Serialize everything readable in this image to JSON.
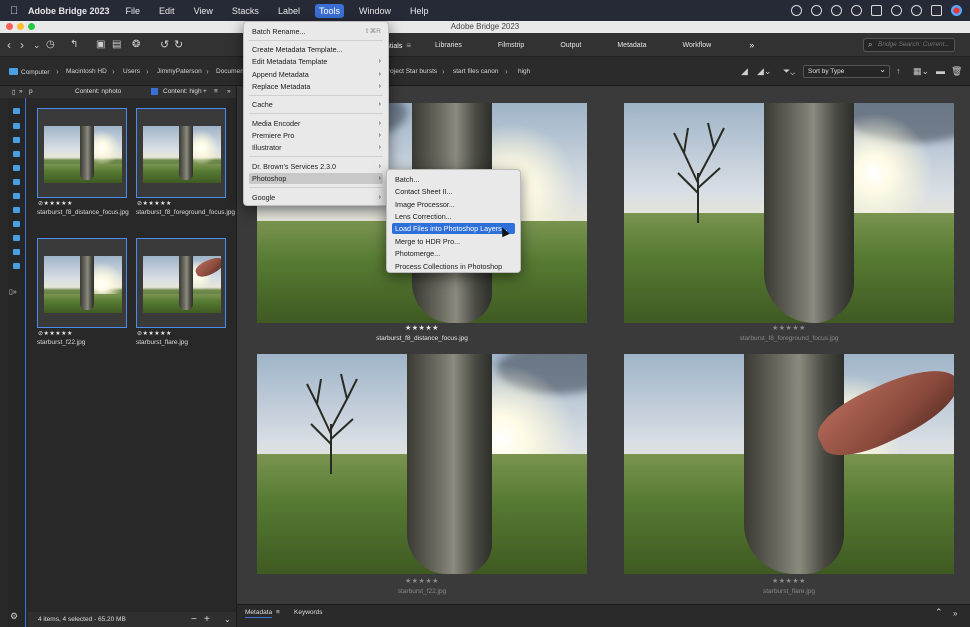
{
  "menubar": {
    "app_name": "Adobe Bridge 2023",
    "items": [
      "File",
      "Edit",
      "View",
      "Stacks",
      "Label",
      "Tools",
      "Window",
      "Help"
    ],
    "active": "Tools"
  },
  "window": {
    "title": "Adobe Bridge 2023"
  },
  "toolbar": {
    "workspace_tabs": [
      "ntials",
      "Libraries",
      "Filmstrip",
      "Output",
      "Metadata",
      "Workflow"
    ],
    "more": "»",
    "search_placeholder": "Bridge Search: Current..."
  },
  "pathbar": {
    "crumbs": [
      "Computer",
      "Macintosh HD",
      "Users",
      "JimmyPaterson",
      "Documen",
      "roject Star bursts",
      "start files canon",
      "high"
    ],
    "sort_label": "Sort by Type"
  },
  "left_panel": {
    "tab_partial": "p",
    "tab_content_nphoto": "Content: nphoto",
    "tab_content_high": "Content: high",
    "thumbnails": [
      {
        "name": "starburst_f8_distance_focus.jpg",
        "rating": "⊘★★★★★"
      },
      {
        "name": "starburst_f8_foreground_focus.jpg",
        "rating": "⊘★★★★★"
      },
      {
        "name": "starburst_f22.jpg",
        "rating": "⊘★★★★★"
      },
      {
        "name": "starburst_flare.jpg",
        "rating": "⊘★★★★★"
      }
    ],
    "status": "4 items, 4 selected - 65.20 MB",
    "minus": "−",
    "plus": "+"
  },
  "content": {
    "items": [
      {
        "name": "starburst_f8_distance_focus.jpg",
        "rating": "★★★★★",
        "selected": true
      },
      {
        "name": "starburst_f8_foreground_focus.jpg",
        "rating": "★★★★★",
        "selected": false
      },
      {
        "name": "starburst_f22.jpg",
        "rating": "★★★★★",
        "selected": false
      },
      {
        "name": "starburst_flare.jpg",
        "rating": "★★★★★",
        "selected": false
      }
    ]
  },
  "bottom_panel": {
    "tabs": [
      "Metadata",
      "Keywords"
    ]
  },
  "tools_menu": {
    "items": [
      {
        "label": "Batch Rename...",
        "shortcut": "⇧⌘R"
      },
      {
        "label": "Create Metadata Template..."
      },
      {
        "label": "Edit Metadata Template",
        "submenu": true
      },
      {
        "label": "Append Metadata",
        "submenu": true
      },
      {
        "label": "Replace Metadata",
        "submenu": true
      },
      {
        "label": "Cache",
        "submenu": true
      },
      {
        "label": "Media Encoder",
        "submenu": true
      },
      {
        "label": "Premiere Pro",
        "submenu": true
      },
      {
        "label": "Illustrator",
        "submenu": true
      },
      {
        "label": "Dr. Brown's Services 2.3.0",
        "submenu": true
      },
      {
        "label": "Photoshop",
        "submenu": true
      },
      {
        "label": "Google",
        "submenu": true
      }
    ]
  },
  "photoshop_submenu": {
    "items": [
      "Batch...",
      "Contact Sheet II...",
      "Image Processor...",
      "Lens Correction...",
      "Load Files into Photoshop Layers...",
      "Merge to HDR Pro...",
      "Photomerge...",
      "Process Collections in Photoshop"
    ],
    "highlighted": "Load Files into Photoshop Layers..."
  },
  "colors": {
    "accent": "#2f6fd9",
    "menubar_bg": "#262a37",
    "panel_bg": "#282828",
    "content_bg": "#3a3a3a"
  }
}
